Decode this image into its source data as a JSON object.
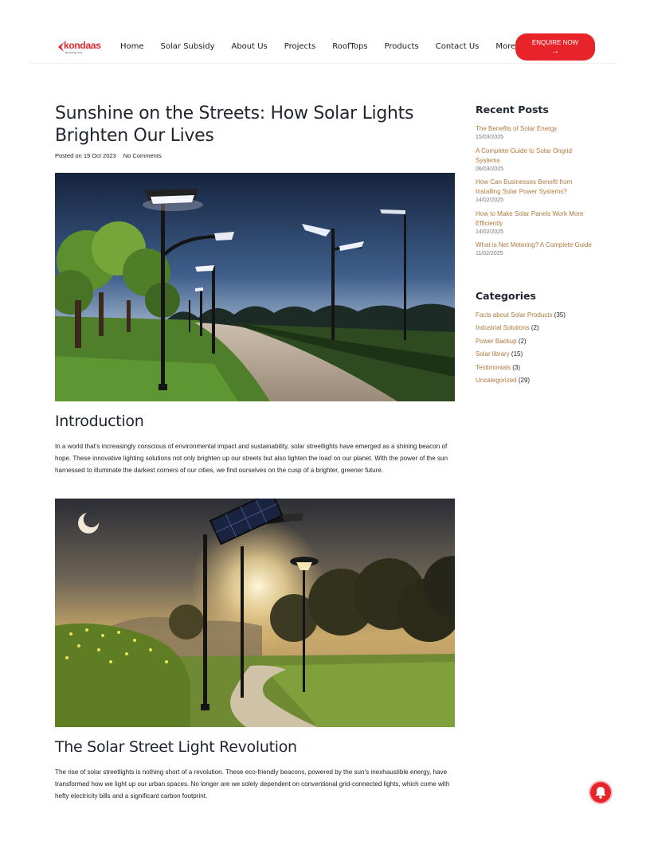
{
  "header": {
    "logo_text": "kondaas",
    "logo_tag": "Renewing Lives",
    "nav": [
      "Home",
      "Solar Subsidy",
      "About Us",
      "Projects",
      "RoofTops",
      "Products",
      "Contact Us",
      "More"
    ],
    "enquire_label": "ENQUIRE NOW",
    "enquire_arrow": "→"
  },
  "article": {
    "title": "Sunshine on the Streets: How Solar Lights Brighten Our Lives",
    "posted": "Posted on 19 Oct 2023",
    "comments": "No Comments",
    "sections": [
      {
        "heading": "Introduction",
        "text": "In a world that's increasingly conscious of environmental impact and sustainability, solar streetlights have emerged as a shining beacon of hope. These innovative lighting solutions not only brighten up our streets but also lighten the load on our planet. With the power of the sun harnessed to illuminate the darkest corners of our cities, we find ourselves on the cusp of a brighter, greener future."
      },
      {
        "heading": "The Solar Street Light Revolution",
        "text": "The rise of solar streetlights is nothing short of a revolution. These eco-friendly beacons, powered by the sun's inexhaustible energy, have transformed how we light up our urban spaces. No longer are we solely dependent on conventional grid-connected lights, which come with hefty electricity bills and a significant carbon footprint."
      }
    ]
  },
  "sidebar": {
    "recent_title": "Recent Posts",
    "posts": [
      {
        "title": "The Benefits of Solar Energy",
        "date": "15/03/2025"
      },
      {
        "title": "A Complete Guide to Solar Ongrid Systems",
        "date": "06/03/2025"
      },
      {
        "title": "How Can Businesses Benefit from Installing Solar Power Systems?",
        "date": "14/02/2025"
      },
      {
        "title": "How to Make Solar Panels Work More Efficiently",
        "date": "14/02/2025"
      },
      {
        "title": "What is Net Metering? A Complete Guide",
        "date": "11/02/2025"
      }
    ],
    "categories_title": "Categories",
    "categories": [
      {
        "name": "Facts about Solar Products",
        "count": "(35)"
      },
      {
        "name": "Industrial Solutions",
        "count": "(2)"
      },
      {
        "name": "Power Backup",
        "count": "(2)"
      },
      {
        "name": "Solar library",
        "count": "(15)"
      },
      {
        "name": "Testimonials",
        "count": "(3)"
      },
      {
        "name": "Uncategorized",
        "count": "(29)"
      }
    ]
  },
  "colors": {
    "accent": "#e8232a",
    "link": "#b07a3c",
    "heading": "#1f2630"
  },
  "icons": [
    "logo-mark-icon",
    "arrow-right-icon",
    "notification-bell-icon"
  ]
}
